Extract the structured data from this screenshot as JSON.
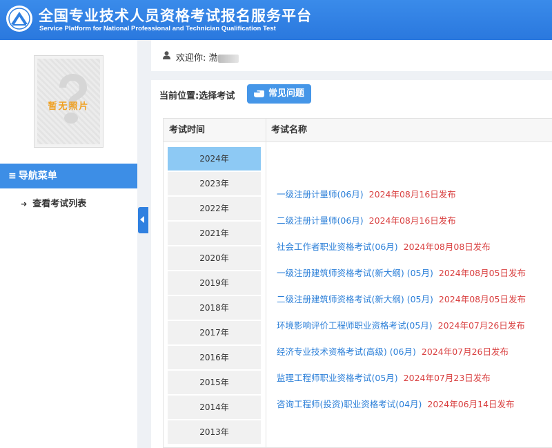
{
  "header": {
    "title_cn": "全国专业技术人员资格考试报名服务平台",
    "title_en": "Service Platform for National Professional and Technician Qualification Test"
  },
  "sidebar": {
    "photo_text": "暂无照片",
    "nav_header": "导航菜单",
    "items": [
      {
        "label": "查看考试列表",
        "icon": "sign-in-icon"
      }
    ]
  },
  "welcome": {
    "label": "欢迎你:",
    "username_visible": "渤"
  },
  "main": {
    "location": "当前位置:选择考试",
    "faq_button": "常见问题",
    "table": {
      "col_time": "考试时间",
      "col_name": "考试名称",
      "years": [
        "2024年",
        "2023年",
        "2022年",
        "2021年",
        "2020年",
        "2019年",
        "2018年",
        "2017年",
        "2016年",
        "2015年",
        "2014年",
        "2013年"
      ],
      "selected_year": "2024年",
      "exams": [
        {
          "name": "一级注册计量师(06月)",
          "date": "2024年08月16日发布"
        },
        {
          "name": "二级注册计量师(06月)",
          "date": "2024年08月16日发布"
        },
        {
          "name": "社会工作者职业资格考试(06月)",
          "date": "2024年08月08日发布"
        },
        {
          "name": "一级注册建筑师资格考试(新大纲) (05月)",
          "date": "2024年08月05日发布"
        },
        {
          "name": "二级注册建筑师资格考试(新大纲) (05月)",
          "date": "2024年08月05日发布"
        },
        {
          "name": "环境影响评价工程师职业资格考试(05月)",
          "date": "2024年07月26日发布"
        },
        {
          "name": "经济专业技术资格考试(高级) (06月)",
          "date": "2024年07月26日发布"
        },
        {
          "name": "监理工程师职业资格考试(05月)",
          "date": "2024年07月23日发布"
        },
        {
          "name": "咨询工程师(投资)职业资格考试(04月)",
          "date": "2024年06月14日发布"
        }
      ]
    }
  },
  "colors": {
    "header": "#2f7fe0",
    "accent": "#3d8ee6",
    "link": "#2b7fd8",
    "date": "#d94040",
    "selected_year": "#8dc9f4"
  }
}
